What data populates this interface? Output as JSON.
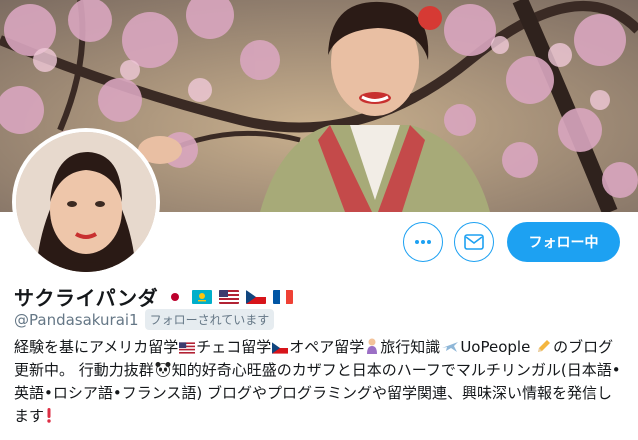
{
  "profile": {
    "display_name": "サクライパンダ",
    "handle": "@Pandasakurai1",
    "follows_you_badge": "フォローされています",
    "name_flags": [
      "japan-flag-icon",
      "kazakhstan-flag-icon",
      "usa-flag-icon",
      "czech-flag-icon",
      "france-flag-icon"
    ]
  },
  "actions": {
    "more_icon": "more-dots-icon",
    "message_icon": "envelope-icon",
    "follow_label": "フォロー中"
  },
  "bio": {
    "p1": "経験を基にアメリカ留学",
    "p2": "チェコ留学",
    "p3": "オペア留学",
    "p4": "旅行知識",
    "p5": "UoPeople",
    "p6": "のブログ更新中。 行動力抜群",
    "p7": "知的好奇心旺盛のカザフと日本のハーフでマルチリンガル(日本語•英語•ロシア語•フランス語) ブログやプログラミングや留学関連、興味深い情報を発信します",
    "icons": [
      "usa-flag-icon",
      "czech-flag-icon",
      "baby-icon",
      "airplane-icon",
      "pencil-icon",
      "panda-icon",
      "exclamation-icon"
    ]
  },
  "colors": {
    "accent": "#1da1f2",
    "text": "#14171a",
    "muted": "#657786",
    "badge_bg": "#e6ecf0"
  }
}
